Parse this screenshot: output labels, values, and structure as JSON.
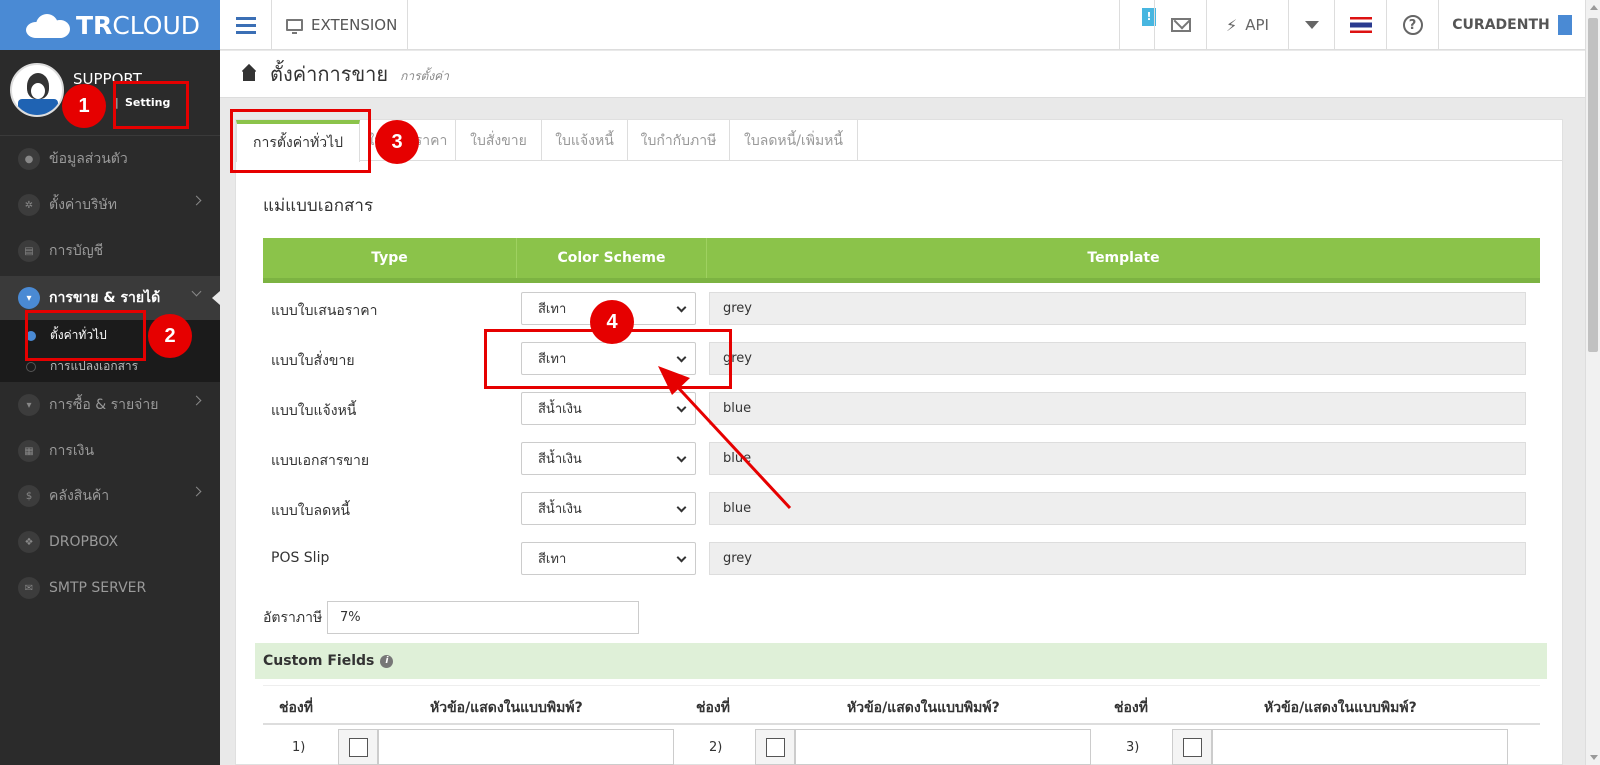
{
  "topbar": {
    "logo_bold": "TR",
    "logo_rest": "CLOUD",
    "extension_label": "EXTENSION",
    "info_badge": "!",
    "api_label": "API",
    "user_label": "CURADENTH",
    "help_glyph": "?"
  },
  "profile": {
    "name": "SUPPORT",
    "separator": "|",
    "setting_link": "Setting"
  },
  "sidebar": {
    "items": [
      {
        "label": "ข้อมูลส่วนตัว",
        "icon": "user-icon"
      },
      {
        "label": "ตั้งค่าบริษัท",
        "icon": "gear-icon"
      },
      {
        "label": "การบัญชี",
        "icon": "book-icon"
      },
      {
        "label": "การขาย & รายได้",
        "icon": "cart-icon"
      },
      {
        "label": "การซื้อ & รายจ่าย",
        "icon": "cart-icon"
      },
      {
        "label": "การเงิน",
        "icon": "calendar-icon"
      },
      {
        "label": "คลังสินค้า",
        "icon": "dollar-icon"
      },
      {
        "label": "DROPBOX",
        "icon": "dropbox-icon"
      },
      {
        "label": "SMTP SERVER",
        "icon": "mail-icon"
      }
    ],
    "sub_items": [
      {
        "label": "ตั้งค่าทั่วไป"
      },
      {
        "label": "การแปลงเอกสาร"
      }
    ]
  },
  "header": {
    "title": "ตั้งค่าการขาย",
    "subtitle": "การตั้งค่า"
  },
  "tabs": [
    {
      "label": "การตั้งค่าทั่วไป"
    },
    {
      "label": "ใบเสนอราคา"
    },
    {
      "label": "ใบสั่งขาย"
    },
    {
      "label": "ใบแจ้งหนี้"
    },
    {
      "label": "ใบกำกับภาษี"
    },
    {
      "label": "ใบลดหนี้/เพิ่มหนี้"
    }
  ],
  "templates": {
    "section_title": "แม่แบบเอกสาร",
    "headers": {
      "type": "Type",
      "color_scheme": "Color Scheme",
      "template": "Template"
    },
    "rows": [
      {
        "type": "แบบใบเสนอราคา",
        "scheme": "สีเทา",
        "template": "grey"
      },
      {
        "type": "แบบใบสั่งขาย",
        "scheme": "สีเทา",
        "template": "grey"
      },
      {
        "type": "แบบใบแจ้งหนี้",
        "scheme": "สีน้ำเงิน",
        "template": "blue"
      },
      {
        "type": "แบบเอกสารขาย",
        "scheme": "สีน้ำเงิน",
        "template": "blue"
      },
      {
        "type": "แบบใบลดหนี้",
        "scheme": "สีน้ำเงิน",
        "template": "blue"
      },
      {
        "type": "POS Slip",
        "scheme": "สีเทา",
        "template": "grey"
      }
    ]
  },
  "tax": {
    "label": "อัตราภาษี",
    "value": "7%"
  },
  "custom_fields": {
    "title": "Custom Fields",
    "info_glyph": "i",
    "col_slot": "ช่องที่",
    "col_header": "หัวข้อ/แสดงในแบบพิมพ์?",
    "rows": [
      {
        "n1": "1)",
        "n2": "2)",
        "n3": "3)"
      }
    ]
  },
  "annotations": {
    "steps": [
      "1",
      "2",
      "3",
      "4"
    ],
    "color": "#e60000"
  },
  "colors": {
    "brand_blue": "#4a8ad4",
    "accent_green": "#8bc34a",
    "sidebar_bg": "#2b2b2b"
  }
}
